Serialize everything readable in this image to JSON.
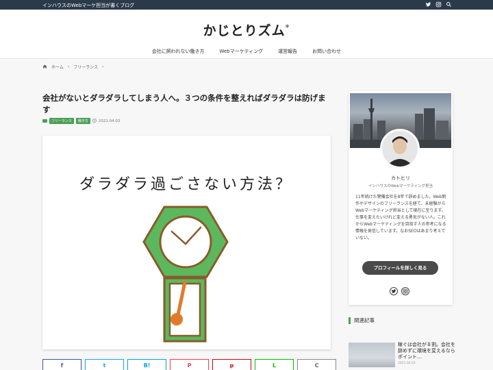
{
  "topbar": {
    "tagline": "インハウスのWebマーケ担当が書くブログ",
    "icons": [
      "twitter-icon",
      "instagram-icon",
      "search-icon"
    ]
  },
  "site": {
    "logo": "かじとりズム",
    "logo_mark": "*"
  },
  "nav": {
    "items": [
      "会社に飼われない働き方",
      "Webマーケティング",
      "運営報告",
      "お問い合わせ"
    ]
  },
  "breadcrumb": {
    "home": "ホーム",
    "category": "フリーランス",
    "separator": "›"
  },
  "post": {
    "title": "会社がないとダラダラしてしまう人へ。３つの条件を整えればダラダラは防げます",
    "tags": [
      "フリーランス",
      "働き方"
    ],
    "date": "2021.04.03",
    "eyecatch_heading": "ダラダラ過ごさない方法？"
  },
  "share": {
    "buttons": [
      "f",
      "t",
      "B!",
      "P",
      "p",
      "L",
      "C"
    ]
  },
  "profile": {
    "name": "カトヒリ",
    "role": "インハウスのWebマーケティング担当",
    "bio": "11年続けた警備会社を8年で辞めました。Web制作やデザインのフリーランスを経て、未経験からWebマーケティング担当として現在に至ります。仕事を変えたいけれど変える勇気がない人。これからWebマーケティングを目指す人の参考になる情報を発信しています。なおSEOはあまり考えていない。",
    "button_label": "プロフィールを詳しく見る"
  },
  "related": {
    "heading": "関連記事",
    "items": [
      {
        "title": "稼ぐは会社が８割。会社を辞めずに環境を変えるならポイント…",
        "date": "2021.04.03"
      }
    ]
  },
  "colors": {
    "accent": "#4b9f58",
    "topbar": "#2b3a4a",
    "clock_green": "#5cb85c",
    "clock_brown": "#8a5a2b",
    "pendulum": "#e07b2a"
  }
}
